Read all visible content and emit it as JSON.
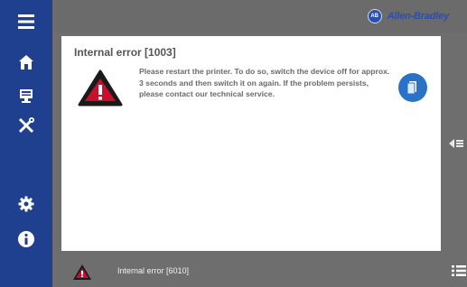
{
  "brand": {
    "logo_text": "AB",
    "name": "Allen-Bradley"
  },
  "sidebar": {
    "items": [
      {
        "icon": "menu-icon"
      },
      {
        "icon": "home-icon"
      },
      {
        "icon": "monitor-icon"
      },
      {
        "icon": "tools-icon"
      },
      {
        "icon": "gear-icon"
      },
      {
        "icon": "info-icon"
      }
    ]
  },
  "dialog": {
    "title": "Internal error [1003]",
    "message": "Please restart the printer. To do so, switch the device off for approx. 3 seconds and then switch it on again. If the problem persists, please contact our technical service.",
    "icon": "warning-icon",
    "action_icon": "document-icon"
  },
  "statusbar": {
    "text": "Internal error [6010]",
    "icon": "warning-icon",
    "list_icon": "list-icon"
  },
  "colors": {
    "sidebar": "#1f3f8f",
    "background": "#6e6e6e",
    "warning_red": "#c8102e",
    "action_blue": "#2a72c6"
  }
}
